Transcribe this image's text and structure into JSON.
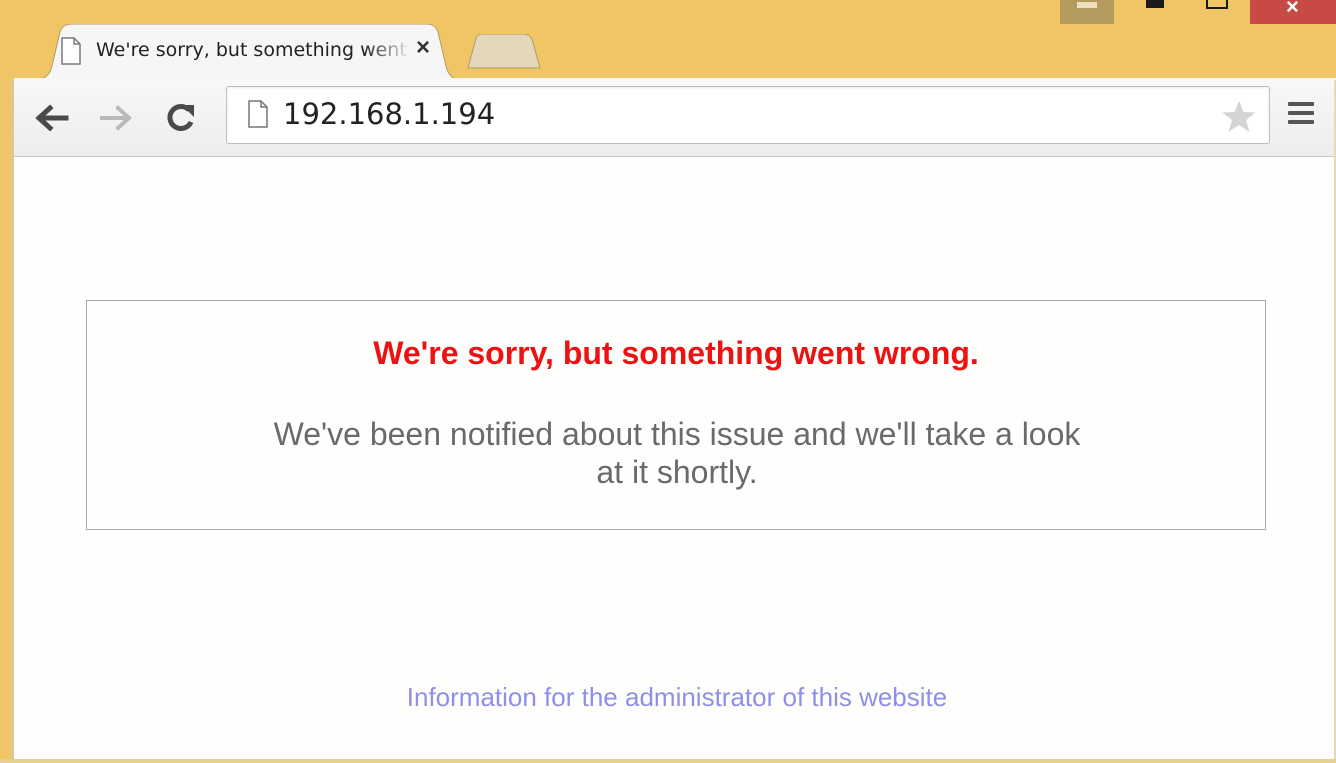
{
  "browser": {
    "tab": {
      "title": "We're sorry, but something went wrong",
      "close_icon": "close-icon"
    },
    "toolbar": {
      "url": "192.168.1.194",
      "icons": [
        "back-arrow-icon",
        "forward-arrow-icon",
        "reload-icon",
        "page-icon",
        "star-icon",
        "menu-icon"
      ]
    },
    "colors": {
      "frame": "#f0c566",
      "close_button": "#c74a45"
    }
  },
  "page": {
    "heading": "We're sorry, but something went wrong.",
    "message": "We've been notified about this issue and we'll take a look at it shortly.",
    "admin_link": "Information for the administrator of this website",
    "colors": {
      "heading": "#ee1111",
      "message": "#6a6a6a",
      "link": "#8f8fe8"
    }
  }
}
